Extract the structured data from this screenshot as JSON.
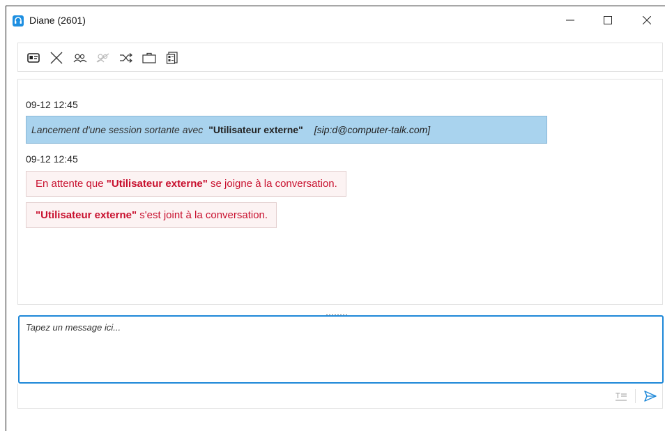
{
  "window": {
    "title": "Diane (2601)"
  },
  "toolbar": {
    "items": [
      {
        "name": "contact-card-icon"
      },
      {
        "name": "close-conversation-icon"
      },
      {
        "name": "add-participant-icon"
      },
      {
        "name": "remove-participant-icon"
      },
      {
        "name": "transfer-icon"
      },
      {
        "name": "briefcase-icon"
      },
      {
        "name": "forms-icon"
      }
    ]
  },
  "chat": {
    "messages": [
      {
        "timestamp": "09-12 12:45",
        "type": "outgoing-session",
        "prefix": "Lancement d'une session sortante avec",
        "user": "\"Utilisateur externe\"",
        "sip": "[sip:d@computer-talk.com]"
      },
      {
        "timestamp": "09-12 12:45",
        "events": [
          {
            "before": "En attente que ",
            "user": "\"Utilisateur externe\"",
            "after": " se joigne à la conversation."
          },
          {
            "before": "",
            "user": "\"Utilisateur externe\"",
            "after": " s'est joint à la conversation."
          }
        ]
      }
    ]
  },
  "composer": {
    "placeholder": "Tapez un message ici..."
  },
  "colors": {
    "accent": "#1e88d8",
    "system_message_bg": "#a9d3ee",
    "event_text": "#c8102e",
    "event_bg": "#fcf3f3"
  }
}
